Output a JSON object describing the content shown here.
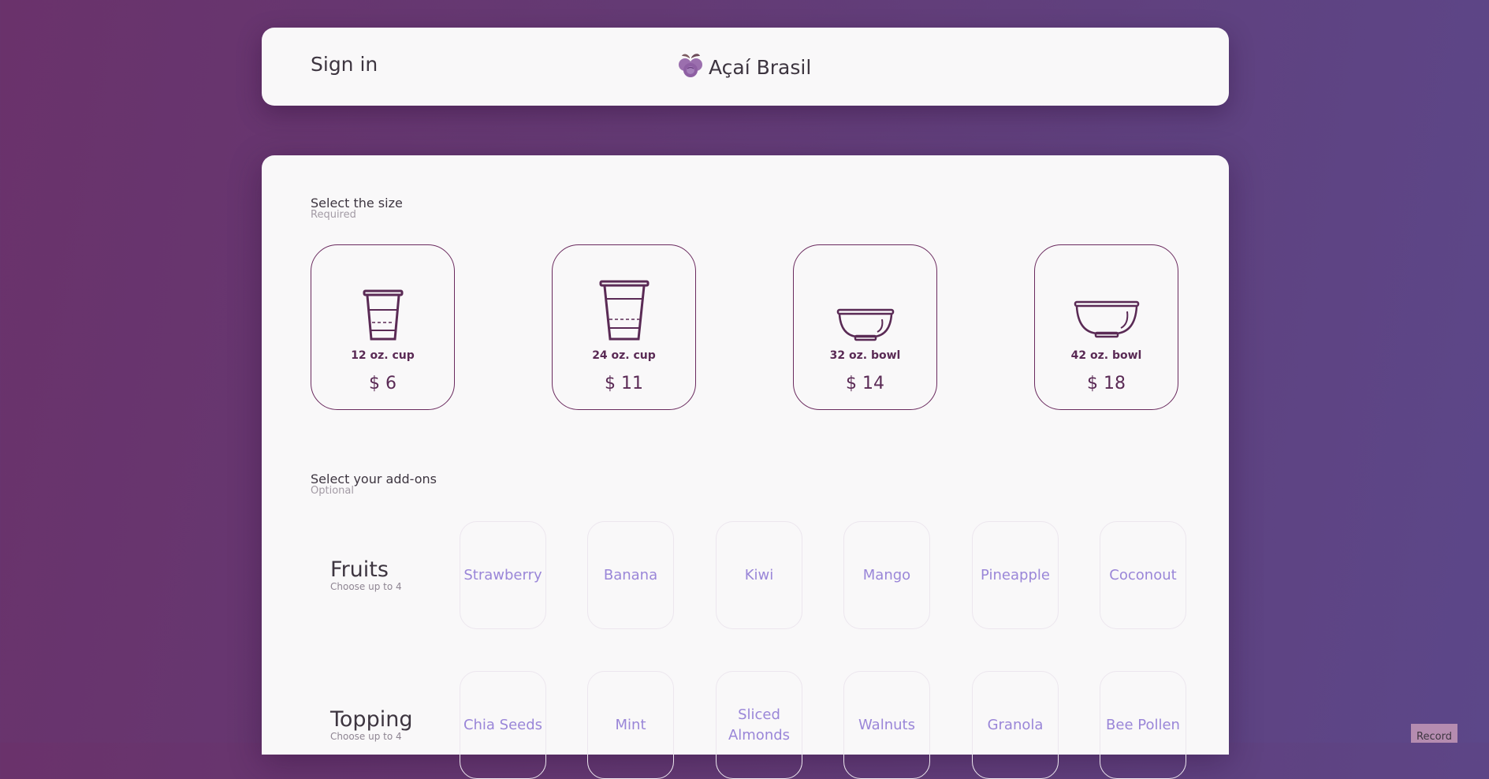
{
  "header": {
    "signin_label": "Sign in",
    "brand_name": "Açaí Brasil",
    "brand_icon": "acai-berry-icon"
  },
  "size_section": {
    "title": "Select the size",
    "subtitle": "Required",
    "options": [
      {
        "name": "12 oz. cup",
        "price": "$ 6",
        "icon": "small-cup-icon"
      },
      {
        "name": "24 oz. cup",
        "price": "$ 11",
        "icon": "large-cup-icon"
      },
      {
        "name": "32 oz. bowl",
        "price": "$ 14",
        "icon": "small-bowl-icon"
      },
      {
        "name": "42 oz. bowl",
        "price": "$ 18",
        "icon": "large-bowl-icon"
      }
    ]
  },
  "addons_section": {
    "title": "Select your add-ons",
    "subtitle": "Optional",
    "groups": [
      {
        "title": "Fruits",
        "subtitle": "Choose up to 4",
        "items": [
          "Strawberry",
          "Banana",
          "Kiwi",
          "Mango",
          "Pineapple",
          "Coconout"
        ]
      },
      {
        "title": "Topping",
        "subtitle": "Choose up to 4",
        "items": [
          "Chia Seeds",
          "Mint",
          "Sliced Almonds",
          "Walnuts",
          "Granola",
          "Bee Pollen"
        ]
      }
    ]
  },
  "record_label": "Record",
  "colors": {
    "accent": "#5a2a55",
    "addon_text": "#9a86d8",
    "background_start": "#6a326b",
    "background_end": "#5c4789"
  }
}
